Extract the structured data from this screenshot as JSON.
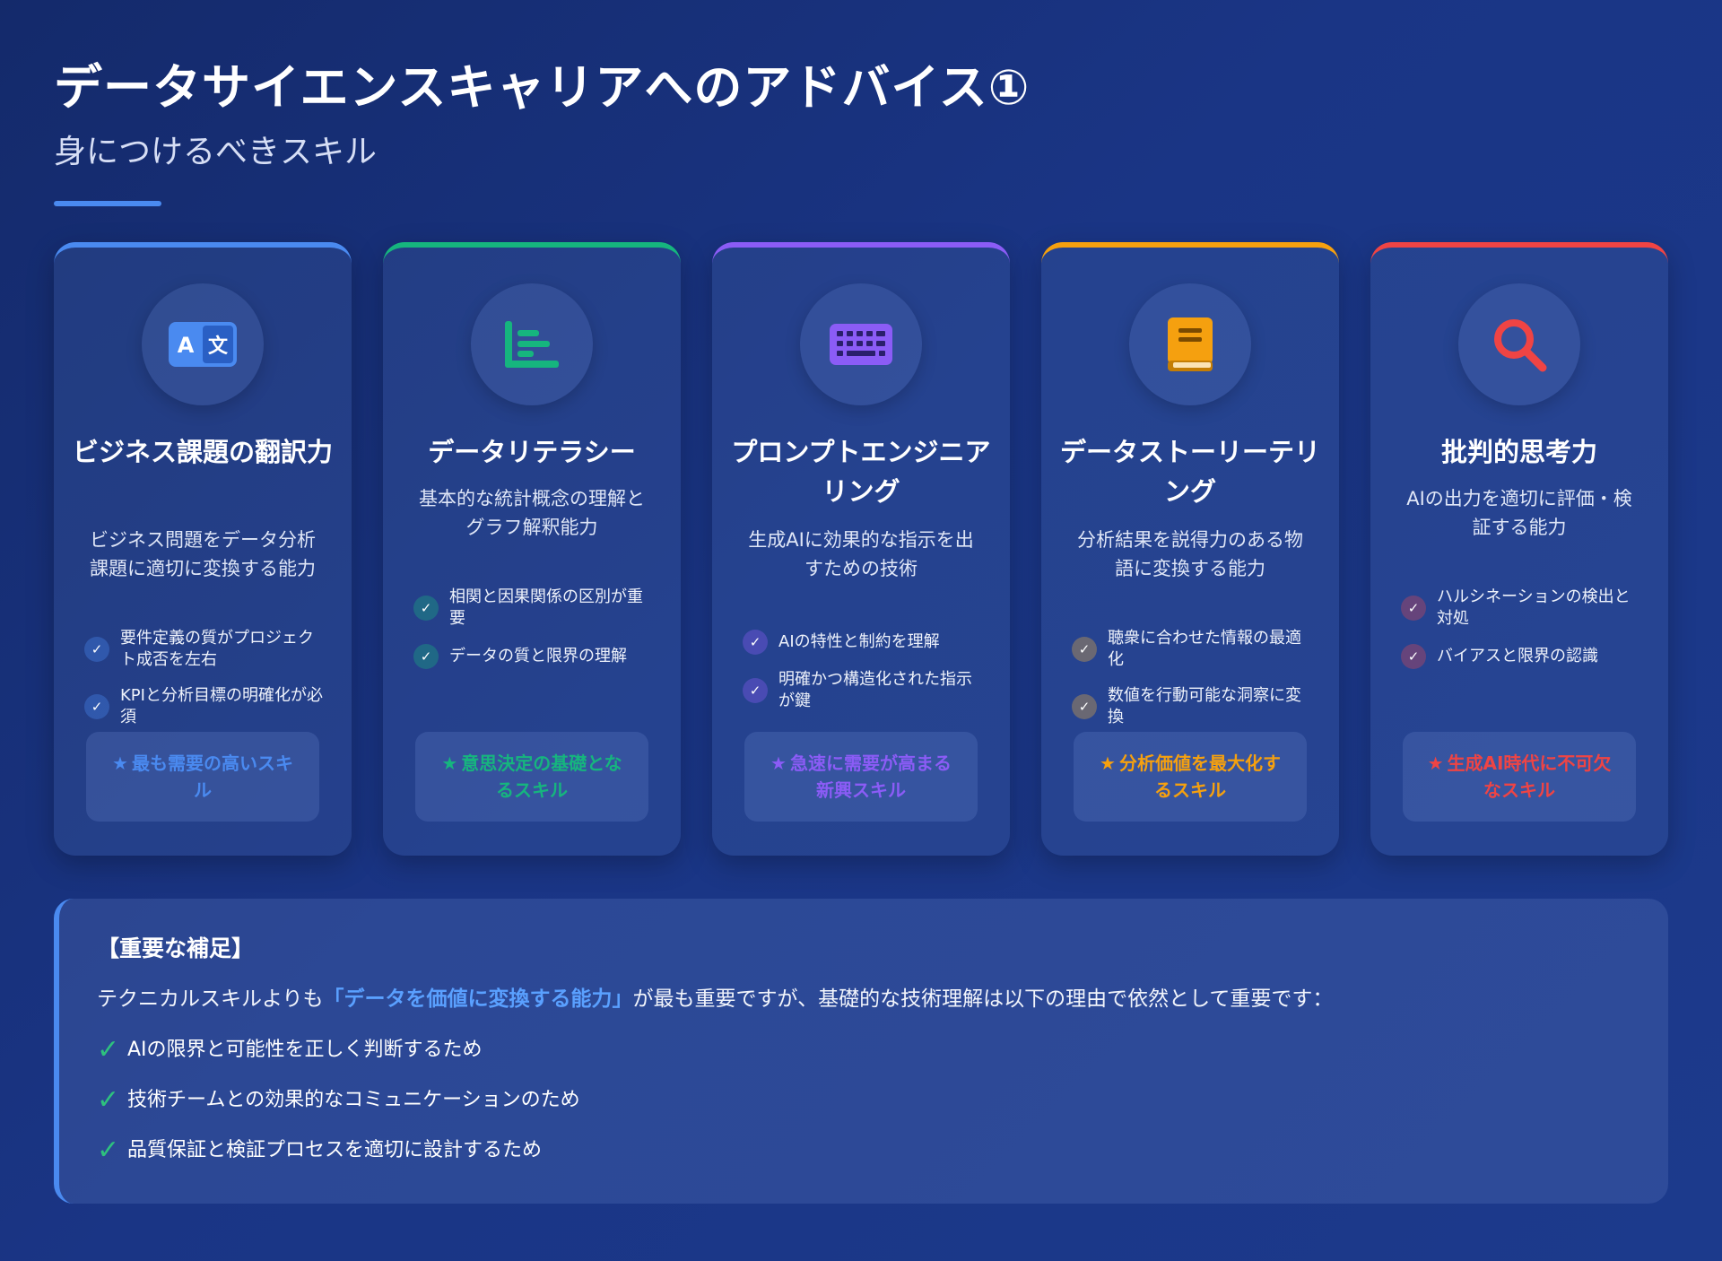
{
  "header": {
    "title": "データサイエンスキャリアへのアドバイス①",
    "subtitle": "身につけるべきスキル"
  },
  "cards": [
    {
      "icon": "translate-icon",
      "accent": "#4a8af0",
      "title": "ビジネス課題の翻訳力",
      "description": "ビジネス問題をデータ分析課題に適切に変換する能力",
      "points": [
        "要件定義の質がプロジェクト成否を左右",
        "KPIと分析目標の明確化が必須"
      ],
      "badge": "最も需要の高いスキル"
    },
    {
      "icon": "chart-icon",
      "accent": "#16b57e",
      "title": "データリテラシー",
      "description": "基本的な統計概念の理解とグラフ解釈能力",
      "points": [
        "相関と因果関係の区別が重要",
        "データの質と限界の理解"
      ],
      "badge": "意思決定の基礎となるスキル"
    },
    {
      "icon": "keyboard-icon",
      "accent": "#8b5cf6",
      "title": "プロンプトエンジニアリング",
      "description": "生成AIに効果的な指示を出すための技術",
      "points": [
        "AIの特性と制約を理解",
        "明確かつ構造化された指示が鍵"
      ],
      "badge": "急速に需要が高まる新興スキル"
    },
    {
      "icon": "book-icon",
      "accent": "#f5a00f",
      "title": "データストーリーテリング",
      "description": "分析結果を説得力のある物語に変換する能力",
      "points": [
        "聴衆に合わせた情報の最適化",
        "数値を行動可能な洞察に変換"
      ],
      "badge": "分析価値を最大化するスキル"
    },
    {
      "icon": "search-icon",
      "accent": "#ef4444",
      "title": "批判的思考力",
      "description": "AIの出力を適切に評価・検証する能力",
      "points": [
        "ハルシネーションの検出と対処",
        "バイアスと限界の認識"
      ],
      "badge": "生成AI時代に不可欠なスキル"
    }
  ],
  "note": {
    "title": "【重要な補足】",
    "body_prefix": "テクニカルスキルよりも",
    "body_highlight": "「データを価値に変換する能力」",
    "body_suffix": "が最も重要ですが、基礎的な技術理解は以下の理由で依然として重要です：",
    "items": [
      "AIの限界と可能性を正しく判断するため",
      "技術チームとの効果的なコミュニケーションのため",
      "品質保証と検証プロセスを適切に設計するため"
    ]
  }
}
